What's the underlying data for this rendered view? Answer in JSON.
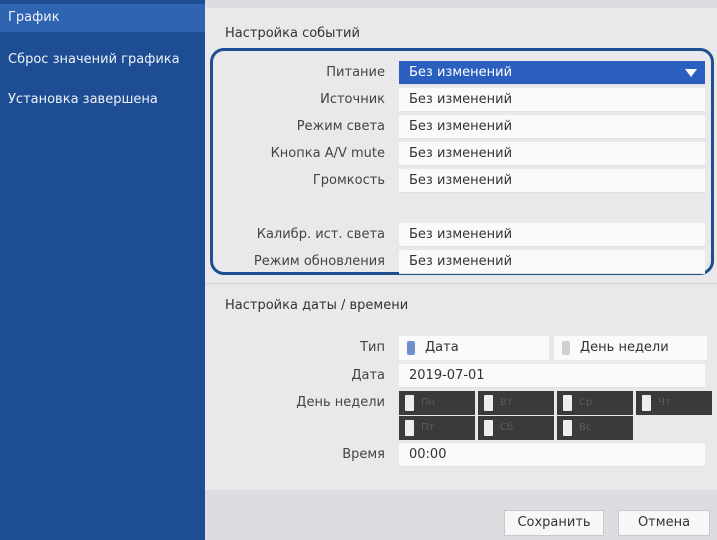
{
  "sidebar": {
    "items": [
      {
        "label": "График"
      },
      {
        "label": "Сброс значений графика"
      },
      {
        "label": "Установка завершена"
      }
    ]
  },
  "events": {
    "title": "Настройка событий",
    "rows": [
      {
        "label": "Питание",
        "value": "Без изменений"
      },
      {
        "label": "Источник",
        "value": "Без изменений"
      },
      {
        "label": "Режим света",
        "value": "Без изменений"
      },
      {
        "label": "Кнопка A/V mute",
        "value": "Без изменений"
      },
      {
        "label": "Громкость",
        "value": "Без изменений"
      },
      {
        "label": "Калибр. ист. света",
        "value": "Без изменений"
      },
      {
        "label": "Режим обновления",
        "value": "Без изменений"
      }
    ]
  },
  "datetime": {
    "title": "Настройка даты / времени",
    "type_label": "Тип",
    "type_options": [
      "Дата",
      "День недели"
    ],
    "type_selected": "Дата",
    "date_label": "Дата",
    "date_value": "2019-07-01",
    "weekday_label": "День недели",
    "weekdays": [
      "Пн",
      "Вт",
      "Ср",
      "Чт",
      "Пт",
      "Сб",
      "Вс"
    ],
    "time_label": "Время",
    "time_value": "00:00"
  },
  "buttons": {
    "save": "Сохранить",
    "cancel": "Отмена"
  },
  "colors": {
    "sidebar_bg": "#1d4e94",
    "sidebar_active": "#2f64b1",
    "selection": "#2b5fbf",
    "focus_frame": "#1f4f8f"
  }
}
